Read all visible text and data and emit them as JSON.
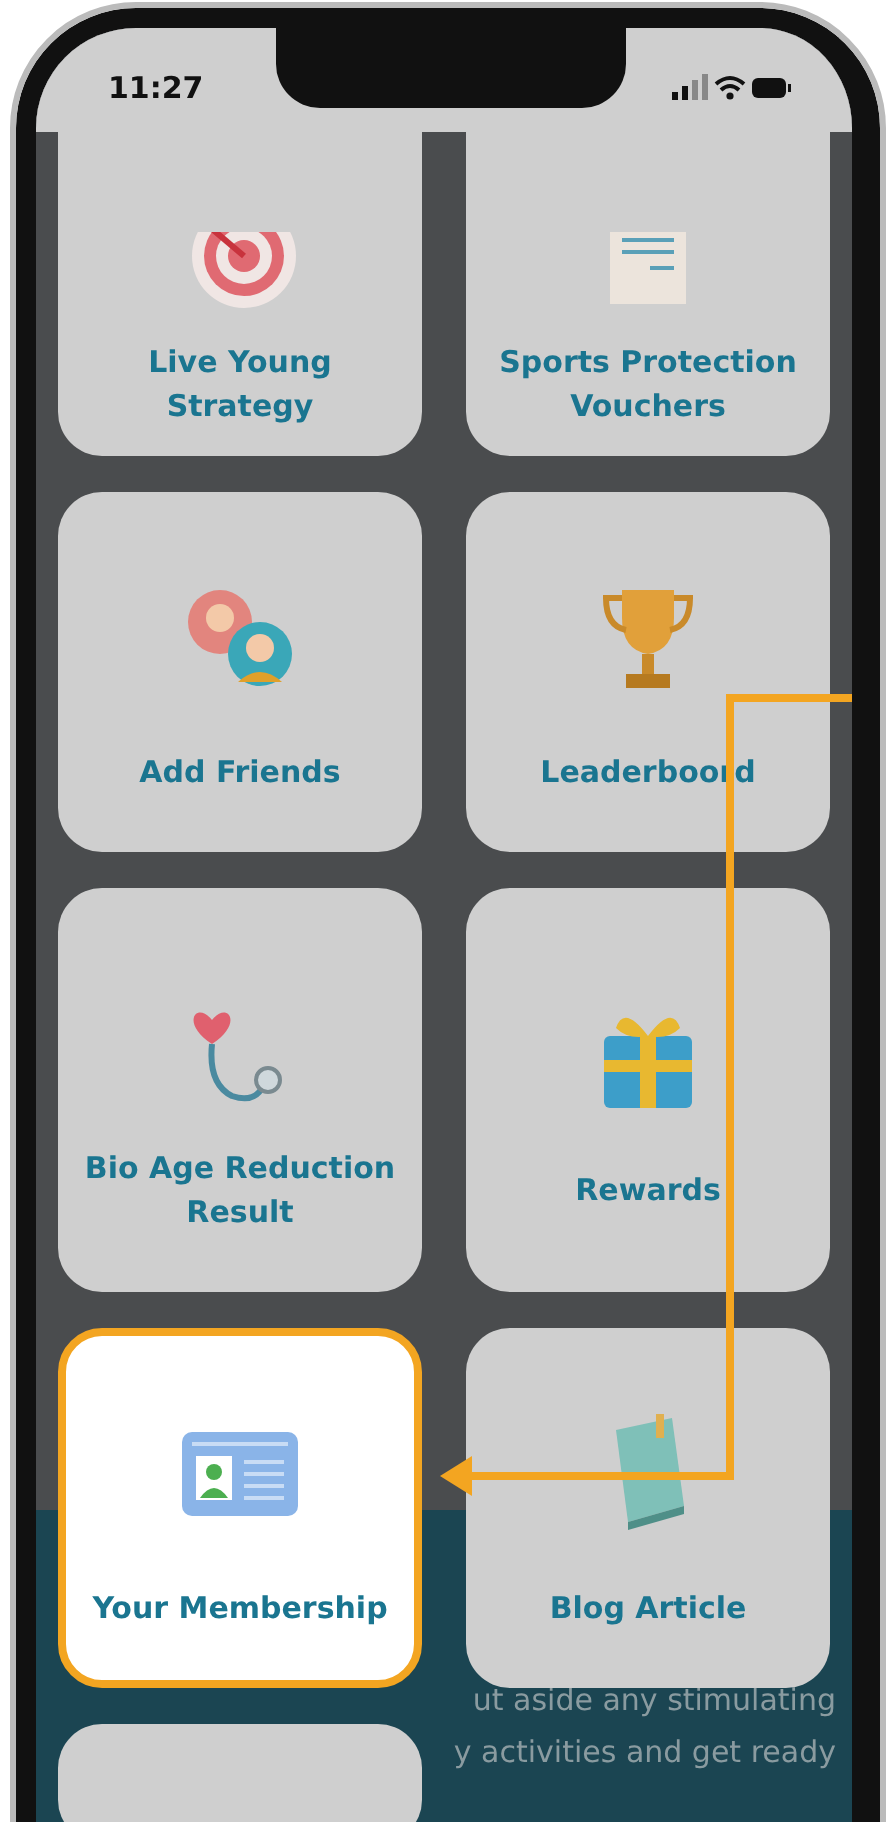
{
  "status_bar": {
    "time": "11:27"
  },
  "tiles": [
    {
      "label": "Live Young Strategy",
      "kind": "target",
      "selected": false
    },
    {
      "label": "Sports Protection Vouchers",
      "kind": "document",
      "selected": false
    },
    {
      "label": "Add Friends",
      "kind": "friends",
      "selected": false
    },
    {
      "label": "Leaderboord",
      "kind": "trophy",
      "selected": false
    },
    {
      "label": "Bio Age Reduction Result",
      "kind": "stethoscope",
      "selected": false
    },
    {
      "label": "Rewards",
      "kind": "gift",
      "selected": false
    },
    {
      "label": "Your Membership",
      "kind": "idcard",
      "selected": true
    },
    {
      "label": "Blog Article",
      "kind": "book",
      "selected": false
    }
  ],
  "background_panel": {
    "lines": [
      "ut aside any stimulating",
      "y activities and get ready"
    ]
  }
}
